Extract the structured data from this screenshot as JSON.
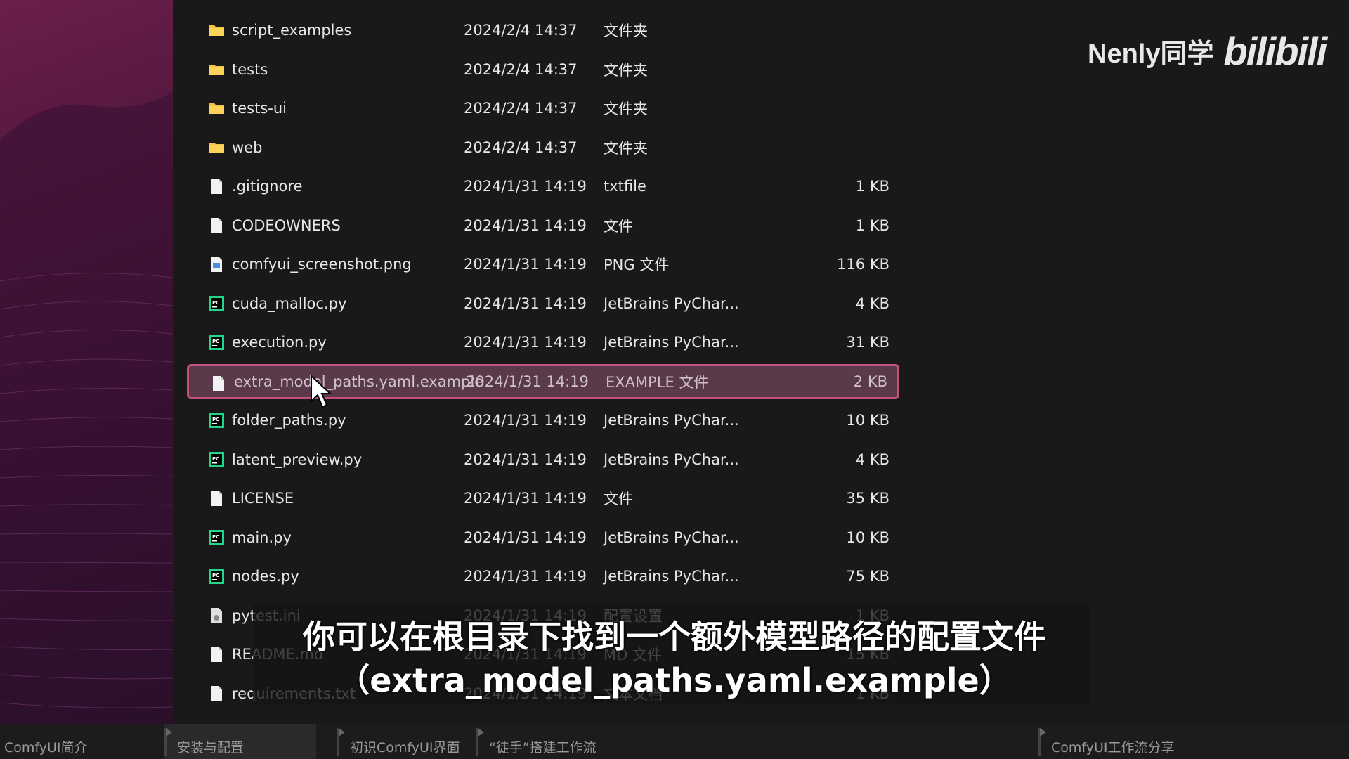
{
  "watermark": {
    "author": "Nenly同学",
    "brand": "bilibili"
  },
  "files": [
    {
      "name": "script_examples",
      "date": "2024/2/4 14:37",
      "type": "文件夹",
      "size": "",
      "icon": "folder-icon"
    },
    {
      "name": "tests",
      "date": "2024/2/4 14:37",
      "type": "文件夹",
      "size": "",
      "icon": "folder-icon"
    },
    {
      "name": "tests-ui",
      "date": "2024/2/4 14:37",
      "type": "文件夹",
      "size": "",
      "icon": "folder-icon"
    },
    {
      "name": "web",
      "date": "2024/2/4 14:37",
      "type": "文件夹",
      "size": "",
      "icon": "folder-icon"
    },
    {
      "name": ".gitignore",
      "date": "2024/1/31 14:19",
      "type": "txtfile",
      "size": "1 KB",
      "icon": "file-icon"
    },
    {
      "name": "CODEOWNERS",
      "date": "2024/1/31 14:19",
      "type": "文件",
      "size": "1 KB",
      "icon": "file-icon"
    },
    {
      "name": "comfyui_screenshot.png",
      "date": "2024/1/31 14:19",
      "type": "PNG 文件",
      "size": "116 KB",
      "icon": "image-file-icon"
    },
    {
      "name": "cuda_malloc.py",
      "date": "2024/1/31 14:19",
      "type": "JetBrains PyChar...",
      "size": "4 KB",
      "icon": "pycharm-file-icon"
    },
    {
      "name": "execution.py",
      "date": "2024/1/31 14:19",
      "type": "JetBrains PyChar...",
      "size": "31 KB",
      "icon": "pycharm-file-icon"
    },
    {
      "name": "extra_model_paths.yaml.example",
      "date": "2024/1/31 14:19",
      "type": "EXAMPLE 文件",
      "size": "2 KB",
      "icon": "file-icon",
      "selected": true
    },
    {
      "name": "folder_paths.py",
      "date": "2024/1/31 14:19",
      "type": "JetBrains PyChar...",
      "size": "10 KB",
      "icon": "pycharm-file-icon"
    },
    {
      "name": "latent_preview.py",
      "date": "2024/1/31 14:19",
      "type": "JetBrains PyChar...",
      "size": "4 KB",
      "icon": "pycharm-file-icon"
    },
    {
      "name": "LICENSE",
      "date": "2024/1/31 14:19",
      "type": "文件",
      "size": "35 KB",
      "icon": "file-icon"
    },
    {
      "name": "main.py",
      "date": "2024/1/31 14:19",
      "type": "JetBrains PyChar...",
      "size": "10 KB",
      "icon": "pycharm-file-icon"
    },
    {
      "name": "nodes.py",
      "date": "2024/1/31 14:19",
      "type": "JetBrains PyChar...",
      "size": "75 KB",
      "icon": "pycharm-file-icon"
    },
    {
      "name": "pytest.ini",
      "date": "2024/1/31 14:19",
      "type": "配置设置",
      "size": "1 KB",
      "icon": "settings-file-icon"
    },
    {
      "name": "README.md",
      "date": "2024/1/31 14:19",
      "type": "MD 文件",
      "size": "15 KB",
      "icon": "file-icon"
    },
    {
      "name": "requirements.txt",
      "date": "2024/1/31 14:19",
      "type": "文本文档",
      "size": "1 KB",
      "icon": "file-icon"
    }
  ],
  "subtitle": {
    "line1": "你可以在根目录下找到一个额外模型路径的配置文件",
    "line2": "（extra_model_paths.yaml.example）"
  },
  "chapters": [
    {
      "label": "ComfyUI简介"
    },
    {
      "label": "安装与配置",
      "active": true
    },
    {
      "label": "初识ComfyUI界面"
    },
    {
      "label": "“徒手”搭建工作流"
    },
    {
      "label": "ComfyUI工作流分享"
    }
  ],
  "colors": {
    "selection_border": "#c2507a",
    "pycharm_green": "#21d789",
    "folder_yellow": "#f5c242"
  }
}
